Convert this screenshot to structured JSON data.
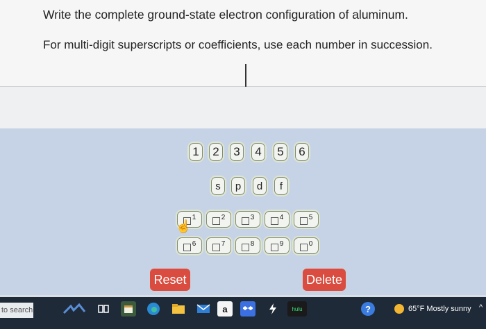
{
  "question": {
    "line1": "Write the complete ground-state electron configuration of aluminum.",
    "line2": "For multi-digit superscripts or coefficients, use each number in succession."
  },
  "keypad": {
    "numbers": [
      "1",
      "2",
      "3",
      "4",
      "5",
      "6"
    ],
    "orbitals": [
      "s",
      "p",
      "d",
      "f"
    ],
    "superscripts_row1": [
      "1",
      "2",
      "3",
      "4",
      "5"
    ],
    "superscripts_row2": [
      "6",
      "7",
      "8",
      "9",
      "0"
    ],
    "reset_label": "Reset",
    "delete_label": "Delete"
  },
  "taskbar": {
    "search_label": "to search",
    "weather_text": "65°F  Mostly sunny",
    "icons": [
      "birds-icon",
      "task-view-icon",
      "calendar-app-icon",
      "edge-icon",
      "file-explorer-icon",
      "mail-icon",
      "amazon-icon",
      "dropbox-icon",
      "flash-icon",
      "hulu-icon",
      "help-icon",
      "weather-icon"
    ]
  },
  "colors": {
    "button_red": "#d94c3f",
    "keypad_bg": "#c6d3e6",
    "taskbar_bg": "#1f2a38"
  }
}
